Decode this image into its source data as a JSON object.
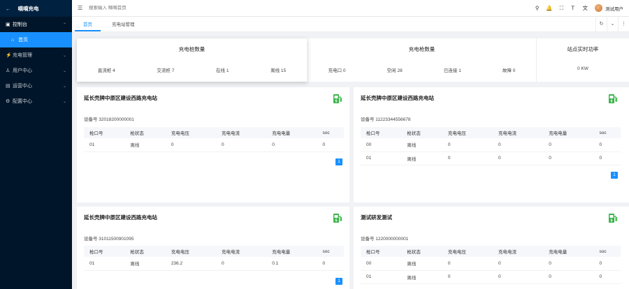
{
  "app": {
    "title": "嘀嘀充电",
    "back_glyph": "←"
  },
  "sidebar": {
    "items": [
      {
        "icon": "▣",
        "label": "控制台",
        "arrow": "⌃"
      },
      {
        "icon": "⌂",
        "label": "首页"
      },
      {
        "icon": "⚡",
        "label": "充电管理",
        "arrow": "⌄"
      },
      {
        "icon": "♙",
        "label": "用户中心",
        "arrow": "⌄"
      },
      {
        "icon": "▤",
        "label": "运营中心",
        "arrow": "⌄"
      },
      {
        "icon": "⚙",
        "label": "配置中心",
        "arrow": "⌄"
      }
    ]
  },
  "header": {
    "search_placeholder": "搜索输入 嘀嘀首页",
    "username": "测试用户",
    "icons": {
      "search": "⚲",
      "bell": "🔔",
      "fullscreen": "⛶",
      "size": "Ｔ",
      "lang": "文"
    }
  },
  "tabs": [
    {
      "label": "首页",
      "active": true
    },
    {
      "label": "充电站管理",
      "active": false
    }
  ],
  "tab_tools": [
    "↻",
    "⌄",
    "⋮"
  ],
  "stats": {
    "piles": {
      "title": "充电桩数量",
      "items": [
        "直流桩 4",
        "交流桩 7",
        "在线 1",
        "离线 15"
      ]
    },
    "guns": {
      "title": "充电枪数量",
      "items": [
        "充电口 0",
        "空闲 28",
        "已连接 1",
        "故障 0"
      ]
    },
    "power": {
      "title": "站点实时功率",
      "value": "0 KW"
    }
  },
  "table_headers": [
    "枪口号",
    "枪状态",
    "充电电压",
    "充电电流",
    "充电电量",
    "soc"
  ],
  "cards": [
    {
      "title": "延长壳牌中原区建设西路充电站",
      "device": "设备号 32018200000001",
      "rows": [
        [
          "01",
          "离线",
          "0",
          "0",
          "0",
          "0"
        ]
      ],
      "page": "1"
    },
    {
      "title": "延长壳牌中原区建设西路充电站",
      "device": "设备号 11223344556678",
      "rows": [
        [
          "00",
          "离线",
          "0",
          "0",
          "0",
          "0"
        ],
        [
          "01",
          "离线",
          "0",
          "0",
          "0",
          "0"
        ]
      ],
      "page": "1"
    },
    {
      "title": "延长壳牌中原区建设西路充电站",
      "device": "设备号 31011500901095",
      "rows": [
        [
          "01",
          "离线",
          "236.2",
          "0",
          "0.1",
          "0"
        ]
      ],
      "page": "1"
    },
    {
      "title": "测试研发测试",
      "device": "设备号 1220000000001",
      "rows": [
        [
          "00",
          "离线",
          "0",
          "0",
          "0",
          "0"
        ],
        [
          "01",
          "离线",
          "0",
          "0",
          "0",
          "0"
        ]
      ],
      "page": ""
    }
  ],
  "colors": {
    "sidebar_bg": "#001529",
    "accent": "#1890ff",
    "icon_green": "#3ab54a"
  }
}
